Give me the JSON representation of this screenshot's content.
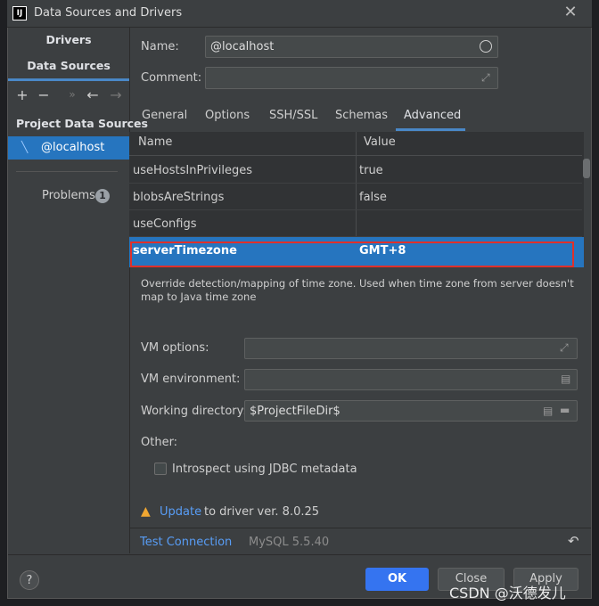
{
  "window": {
    "title": "Data Sources and Drivers",
    "app_icon_text": "IJ"
  },
  "left": {
    "tabs": [
      "Drivers",
      "Data Sources"
    ],
    "section_title": "Project Data Sources",
    "selected_item": "@localhost",
    "problems_label": "Problems",
    "problems_count": "1"
  },
  "form": {
    "name_label": "Name:",
    "name_value": "@localhost",
    "comment_label": "Comment:",
    "tabs": [
      "General",
      "Options",
      "SSH/SSL",
      "Schemas",
      "Advanced"
    ],
    "active_tab": "Advanced"
  },
  "table": {
    "headers": [
      "Name",
      "Value"
    ],
    "rows": [
      {
        "name": "useHostsInPrivileges",
        "value": "true"
      },
      {
        "name": "blobsAreStrings",
        "value": "false"
      },
      {
        "name": "useConfigs",
        "value": ""
      }
    ],
    "selected": {
      "name": "serverTimezone",
      "value": "GMT+8"
    }
  },
  "description": "Override detection/mapping of time zone. Used when time zone from server doesn't map to Java time zone",
  "vm": {
    "options_label": "VM options:",
    "environment_label": "VM environment:",
    "working_dir_label": "Working directory:",
    "working_dir_value": "$ProjectFileDir$",
    "other_label": "Other:",
    "introspect_label": "Introspect using JDBC metadata"
  },
  "driver": {
    "update_link": "Update",
    "update_text": "to driver ver. 8.0.25"
  },
  "footer": {
    "test_connection": "Test Connection",
    "db_version": "MySQL 5.5.40",
    "help": "?",
    "ok": "OK",
    "close": "Close",
    "apply": "Apply"
  },
  "watermark": "CSDN @沃德发儿",
  "colors": {
    "accent": "#2675bf",
    "link": "#589df6",
    "highlight_border": "#e0302a",
    "warning": "#f0a732"
  }
}
